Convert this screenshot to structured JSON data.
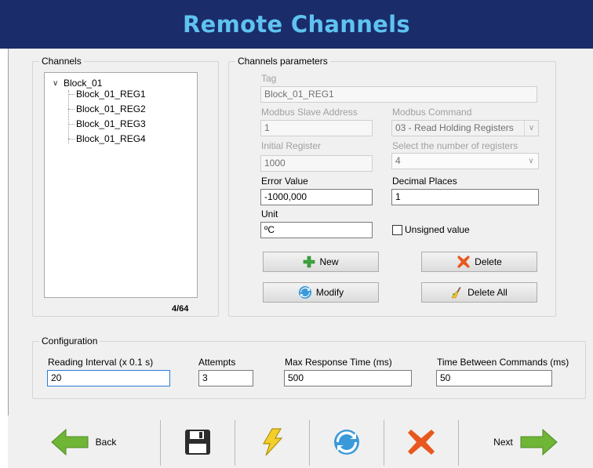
{
  "title": "Remote Channels",
  "channels_group": {
    "legend": "Channels",
    "root": "Block_01",
    "children": [
      "Block_01_REG1",
      "Block_01_REG2",
      "Block_01_REG3",
      "Block_01_REG4"
    ],
    "counter": "4/64"
  },
  "params_group": {
    "legend": "Channels parameters",
    "tag_label": "Tag",
    "tag_value": "Block_01_REG1",
    "slave_label": "Modbus Slave Address",
    "slave_value": "1",
    "command_label": "Modbus Command",
    "command_value": "03 - Read Holding Registers",
    "initial_label": "Initial Register",
    "initial_value": "1000",
    "num_regs_label": "Select the number of registers",
    "num_regs_value": "4",
    "error_label": "Error Value",
    "error_value": "-1000,000",
    "decimal_label": "Decimal Places",
    "decimal_value": "1",
    "unit_label": "Unit",
    "unit_value": "ºC",
    "unsigned_label": "Unsigned value",
    "new_label": "New",
    "delete_label": "Delete",
    "modify_label": "Modify",
    "delete_all_label": "Delete All"
  },
  "config_group": {
    "legend": "Configuration",
    "interval_label": "Reading Interval (x 0.1 s)",
    "interval_value": "20",
    "attempts_label": "Attempts",
    "attempts_value": "3",
    "max_resp_label": "Max Response Time (ms)",
    "max_resp_value": "500",
    "between_label": "Time Between Commands (ms)",
    "between_value": "50"
  },
  "toolbar": {
    "back_label": "Back",
    "next_label": "Next",
    "icons": [
      "save-icon",
      "lightning-icon",
      "refresh-icon",
      "cancel-icon"
    ]
  },
  "colors": {
    "title_bg": "#1b2c6b",
    "title_text": "#5fc3f0",
    "arrow_green": "#6fb536",
    "red_x": "#e8571e",
    "refresh_blue": "#3a9ad9"
  }
}
